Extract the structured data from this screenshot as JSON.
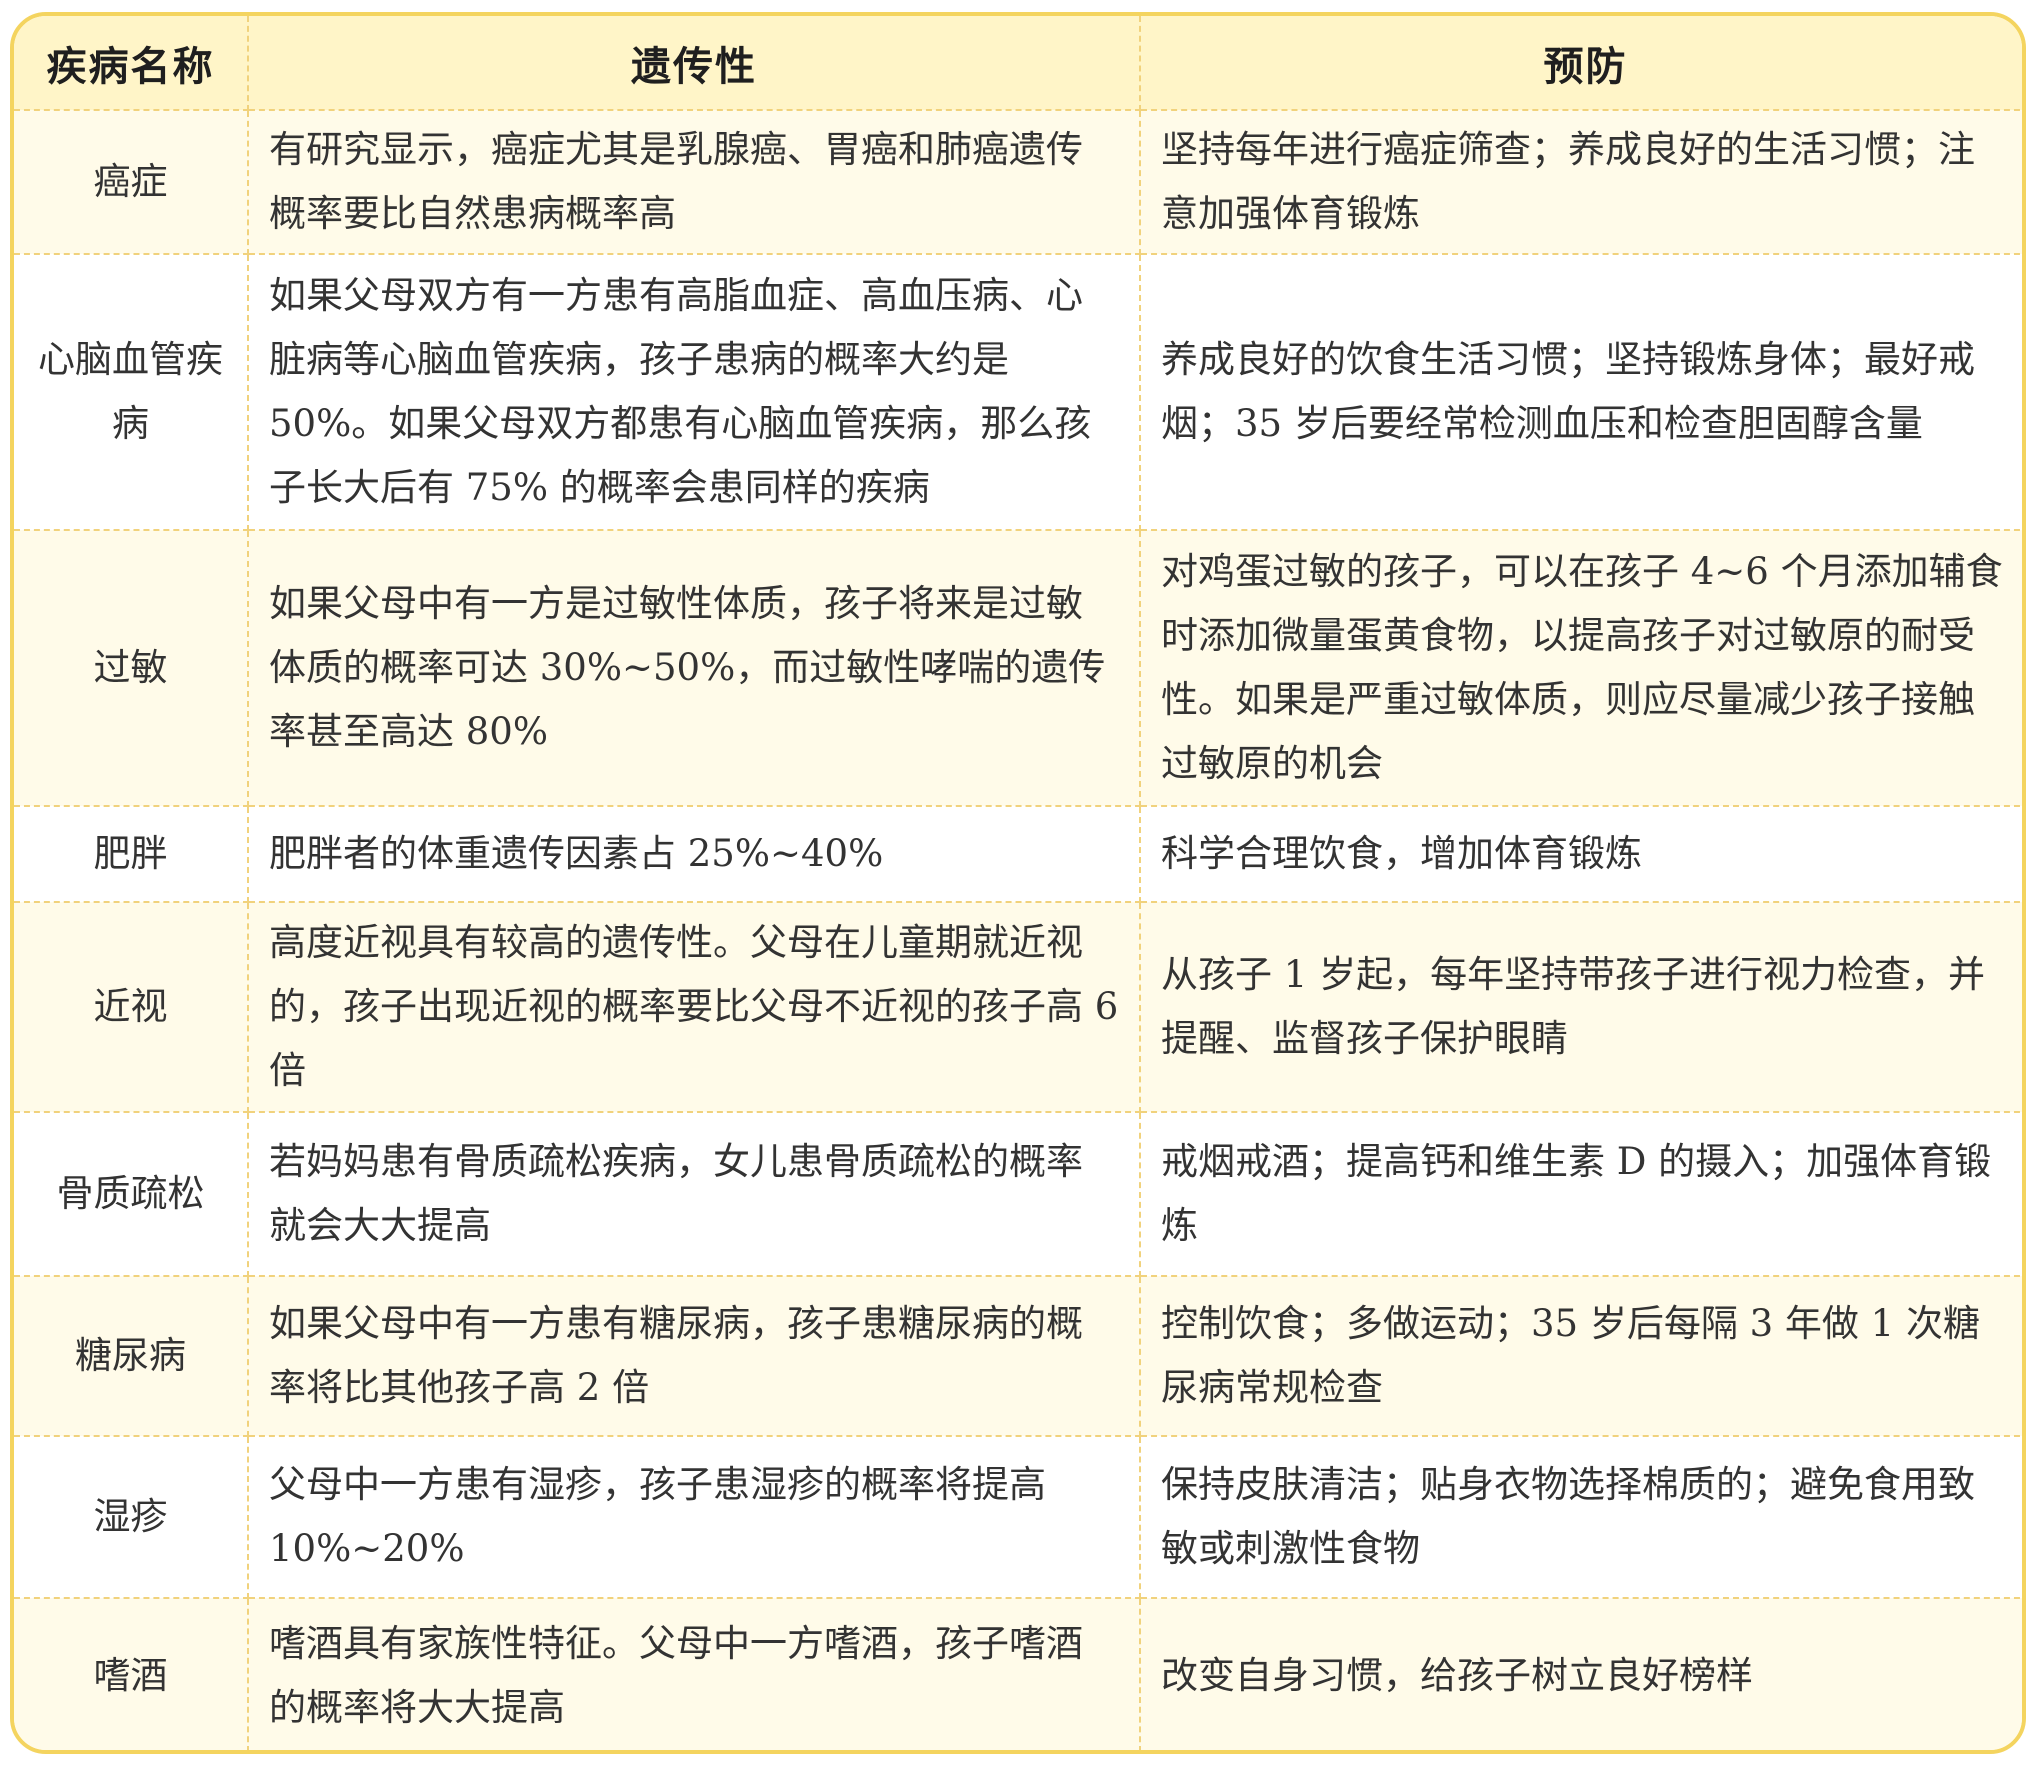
{
  "table": {
    "headers": [
      "疾病名称",
      "遗传性",
      "预防"
    ],
    "rows": [
      {
        "disease": "癌症",
        "heredity": "有研究显示，癌症尤其是乳腺癌、胃癌和肺癌遗传概率要比自然患病概率高",
        "prevention": "坚持每年进行癌症筛查；养成良好的生活习惯；注意加强体育锻炼"
      },
      {
        "disease": "心脑血管疾病",
        "heredity": "如果父母双方有一方患有高脂血症、高血压病、心脏病等心脑血管疾病，孩子患病的概率大约是50%。如果父母双方都患有心脑血管疾病，那么孩子长大后有 75% 的概率会患同样的疾病",
        "prevention": "养成良好的饮食生活习惯；坚持锻炼身体；最好戒烟；35 岁后要经常检测血压和检查胆固醇含量"
      },
      {
        "disease": "过敏",
        "heredity": "如果父母中有一方是过敏性体质，孩子将来是过敏体质的概率可达 30%~50%，而过敏性哮喘的遗传率甚至高达 80%",
        "prevention": "对鸡蛋过敏的孩子，可以在孩子 4~6 个月添加辅食时添加微量蛋黄食物，以提高孩子对过敏原的耐受性。如果是严重过敏体质，则应尽量减少孩子接触过敏原的机会"
      },
      {
        "disease": "肥胖",
        "heredity": "肥胖者的体重遗传因素占 25%~40%",
        "prevention": "科学合理饮食，增加体育锻炼"
      },
      {
        "disease": "近视",
        "heredity": "高度近视具有较高的遗传性。父母在儿童期就近视的，孩子出现近视的概率要比父母不近视的孩子高 6 倍",
        "prevention": "从孩子 1 岁起，每年坚持带孩子进行视力检查，并提醒、监督孩子保护眼睛"
      },
      {
        "disease": "骨质疏松",
        "heredity": "若妈妈患有骨质疏松疾病，女儿患骨质疏松的概率就会大大提高",
        "prevention": "戒烟戒酒；提高钙和维生素 D 的摄入；加强体育锻炼"
      },
      {
        "disease": "糖尿病",
        "heredity": "如果父母中有一方患有糖尿病，孩子患糖尿病的概率将比其他孩子高 2 倍",
        "prevention": "控制饮食；多做运动；35 岁后每隔 3 年做 1 次糖尿病常规检查"
      },
      {
        "disease": "湿疹",
        "heredity": "父母中一方患有湿疹，孩子患湿疹的概率将提高 10%~20%",
        "prevention": "保持皮肤清洁；贴身衣物选择棉质的；避免食用致敏或刺激性食物"
      },
      {
        "disease": "嗜酒",
        "heredity": "嗜酒具有家族性特征。父母中一方嗜酒，孩子嗜酒的概率将大大提高",
        "prevention": "改变自身习惯，给孩子树立良好榜样"
      }
    ]
  }
}
